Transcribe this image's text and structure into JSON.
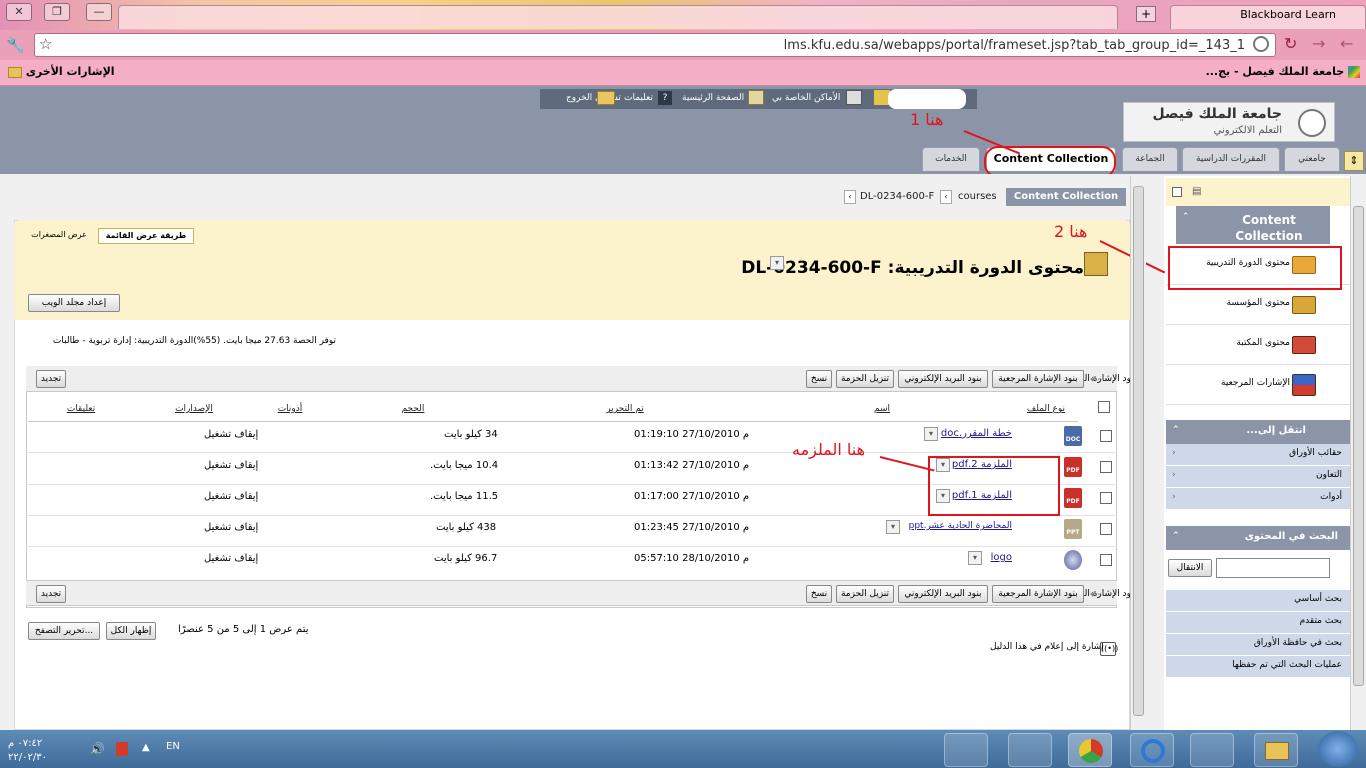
{
  "browser": {
    "tab_title": "Blackboard Learn",
    "url": "lms.kfu.edu.sa/webapps/portal/frameset.jsp?tab_tab_group_id=_143_1",
    "bookmarks": {
      "left_folder": "الإشارات الأخرى",
      "site": "جامعة الملك فيصل - بج..."
    }
  },
  "topnav": {
    "logout": "تسجيل الخروج",
    "help": "تعليمات",
    "home": "الصفحة الرئيسية",
    "my_places": "الأماكن الخاصة بي"
  },
  "logo": {
    "name": "جامعة الملك فيصل",
    "sub": "التعلم الالكتروني"
  },
  "tabs": {
    "my_institution": "جامعتي",
    "courses": "المقررات الدراسية",
    "community": "الجماعة",
    "content_collection": "Content Collection",
    "services": "الخدمات"
  },
  "breadcrumb": {
    "root": "Content Collection",
    "level1": "courses",
    "level2": "DL-0234-600-F"
  },
  "view": {
    "list_view": "طريقة عرض القائمة",
    "thumbnail_view": "عرض المصغرات"
  },
  "page_title": "محتوى الدورة التدريبية: DL-0234-600-F",
  "setup_web_folder": "إعداد مجلد الويب",
  "quota": "توفر الحصة  27.63  ميجا بايت. (55%)الدورة التدريبية:  إدارة تربوية - طالبات",
  "toolbar": {
    "bookmark": "بنود الإشارة المرجعية",
    "email": "بنود البريد الإلكتروني",
    "download": "تنزيل الحزمة",
    "copy": "نسخ",
    "refresh": "تجديد"
  },
  "columns": {
    "type": "نوع الملف",
    "name": "اسم",
    "modified": "تم التحرير",
    "size": "الحجم",
    "permissions": "أذونات",
    "versions": "الإصدارات",
    "comments": "تعليقات"
  },
  "rows": [
    {
      "name": "خطة المقرر.doc",
      "modified": "01:19:10 27/10/2010 م",
      "size": "34 كيلو بايت",
      "versions": "إيقاف تشغيل",
      "icon": "doc"
    },
    {
      "name": "الملزمة 2.pdf",
      "modified": "01:13:42 27/10/2010 م",
      "size": "10.4 ميجا بايت.",
      "versions": "إيقاف تشغيل",
      "icon": "pdf"
    },
    {
      "name": "الملزمة 1.pdf",
      "modified": "01:17:00 27/10/2010 م",
      "size": "11.5 ميجا بايت.",
      "versions": "إيقاف تشغيل",
      "icon": "pdf"
    },
    {
      "name": "المحاضرة الحادية عشر.ppt",
      "modified": "01:23:45 27/10/2010 م",
      "size": "438 كيلو بايت",
      "versions": "إيقاف تشغيل",
      "icon": "ppt"
    },
    {
      "name": "logo",
      "modified": "05:57:10 28/10/2010 م",
      "size": "96.7 كيلو بايت",
      "versions": "إيقاف تشغيل",
      "icon": "logo"
    }
  ],
  "pagination": {
    "summary": "يتم عرض 1 إلى 5 من 5 عنصرًا",
    "show_all": "إظهار الكل",
    "edit_paging": "تحرير التصفح..."
  },
  "notify": "إشارة إلى إعلام في هذا الدليل",
  "sidebar": {
    "header": "Content Collection",
    "items": [
      "محتوى الدورة التدريبية",
      "محتوى المؤسسة",
      "محتوى المكتبة",
      "الإشارات المرجعية"
    ],
    "goto_header": "انتقل إلى...",
    "goto_items": [
      "حقائب الأوراق",
      "التعاون",
      "أدوات"
    ],
    "search_header": "البحث في المحتوى",
    "search_button": "الانتقال",
    "search_links": [
      "بحث أساسي",
      "بحث متقدم",
      "بحث في حافظة الأوراق",
      "عمليات البحث التي تم حفظها"
    ]
  },
  "annotations": {
    "here1": "هنا 1",
    "here2": "هنا 2",
    "here_booklet": "هنا الملزمه"
  },
  "taskbar": {
    "lang": "EN",
    "time": "٠٧:٤٢ م",
    "date": "٢٢/٠٢/٣٠"
  }
}
